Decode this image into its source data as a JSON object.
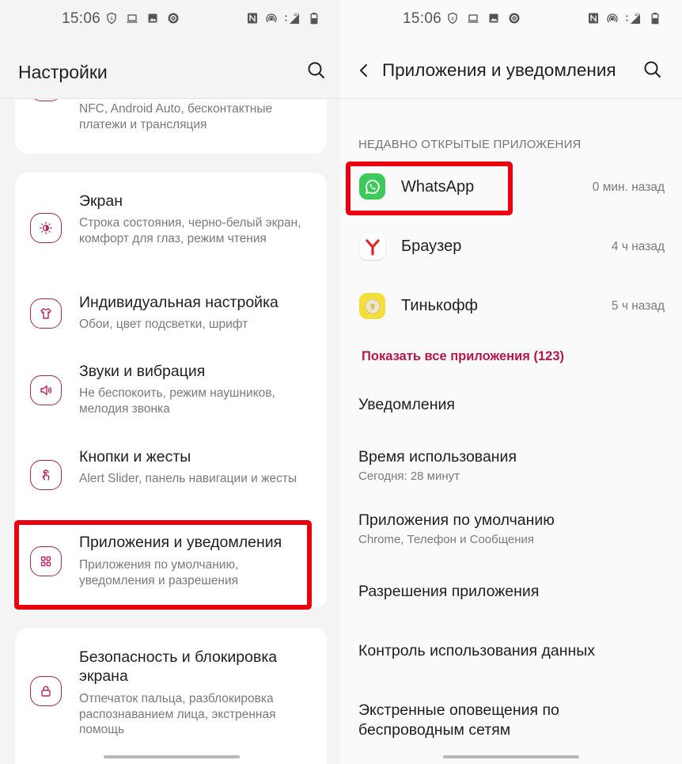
{
  "status_bar": {
    "time": "15:06",
    "left_icons": [
      "shield-4-icon",
      "laptop-icon",
      "image-icon",
      "media-circle-icon"
    ],
    "right_icons": [
      "nfc-icon",
      "hotspot-icon",
      "signal-4g-icon",
      "battery-icon"
    ],
    "network_label": "4G"
  },
  "left_screen": {
    "title": "Настройки",
    "search_icon": "search-icon",
    "items": [
      {
        "icon": "nfc-connection-icon",
        "title": "",
        "subtitle": "NFC, Android Auto, бесконтактные платежи и трансляция"
      },
      {
        "icon": "brightness-icon",
        "title": "Экран",
        "subtitle": "Строка состояния, черно-белый экран, комфорт для глаз, режим чтения"
      },
      {
        "icon": "tshirt-icon",
        "title": "Индивидуальная настройка",
        "subtitle": "Обои, цвет подсветки, шрифт"
      },
      {
        "icon": "speaker-icon",
        "title": "Звуки и вибрация",
        "subtitle": "Не беспокоить, режим наушников, мелодия звонка"
      },
      {
        "icon": "gesture-icon",
        "title": "Кнопки и жесты",
        "subtitle": "Alert Slider, панель навигации и жесты"
      },
      {
        "icon": "apps-grid-icon",
        "title": "Приложения и уведомления",
        "subtitle": "Приложения по умолчанию, уведомления и разрешения",
        "highlighted": true
      },
      {
        "icon": "lock-icon",
        "title": "Безопасность и блокировка экрана",
        "subtitle": "Отпечаток пальца, разблокировка распознаванием лица, экстренная помощь"
      }
    ]
  },
  "right_screen": {
    "title": "Приложения и уведомления",
    "back_icon": "chevron-left-icon",
    "search_icon": "search-icon",
    "recent_header": "НЕДАВНО ОТКРЫТЫЕ ПРИЛОЖЕНИЯ",
    "recent_apps": [
      {
        "name": "WhatsApp",
        "time": "0 мин. назад",
        "icon": "whatsapp-icon",
        "highlighted": true
      },
      {
        "name": "Браузер",
        "time": "4 ч назад",
        "icon": "yandex-browser-icon"
      },
      {
        "name": "Тинькофф",
        "time": "5 ч назад",
        "icon": "tinkoff-icon"
      }
    ],
    "show_all": "Показать все приложения (123)",
    "menu": [
      {
        "title": "Уведомления",
        "subtitle": ""
      },
      {
        "title": "Время использования",
        "subtitle": "Сегодня: 28 минут"
      },
      {
        "title": "Приложения по умолчанию",
        "subtitle": "Chrome, Телефон и Сообщения"
      },
      {
        "title": "Разрешения приложения",
        "subtitle": ""
      },
      {
        "title": "Контроль использования данных",
        "subtitle": ""
      },
      {
        "title": "Экстренные оповещения по беспроводным сетям",
        "subtitle": ""
      }
    ]
  },
  "colors": {
    "accent": "#b3174c",
    "icon_outline": "#9b2b52",
    "highlight_box": "#e8000e",
    "whatsapp": "#3ec95b",
    "tinkoff": "#f5dd3a",
    "yandex": "#e3262b"
  }
}
